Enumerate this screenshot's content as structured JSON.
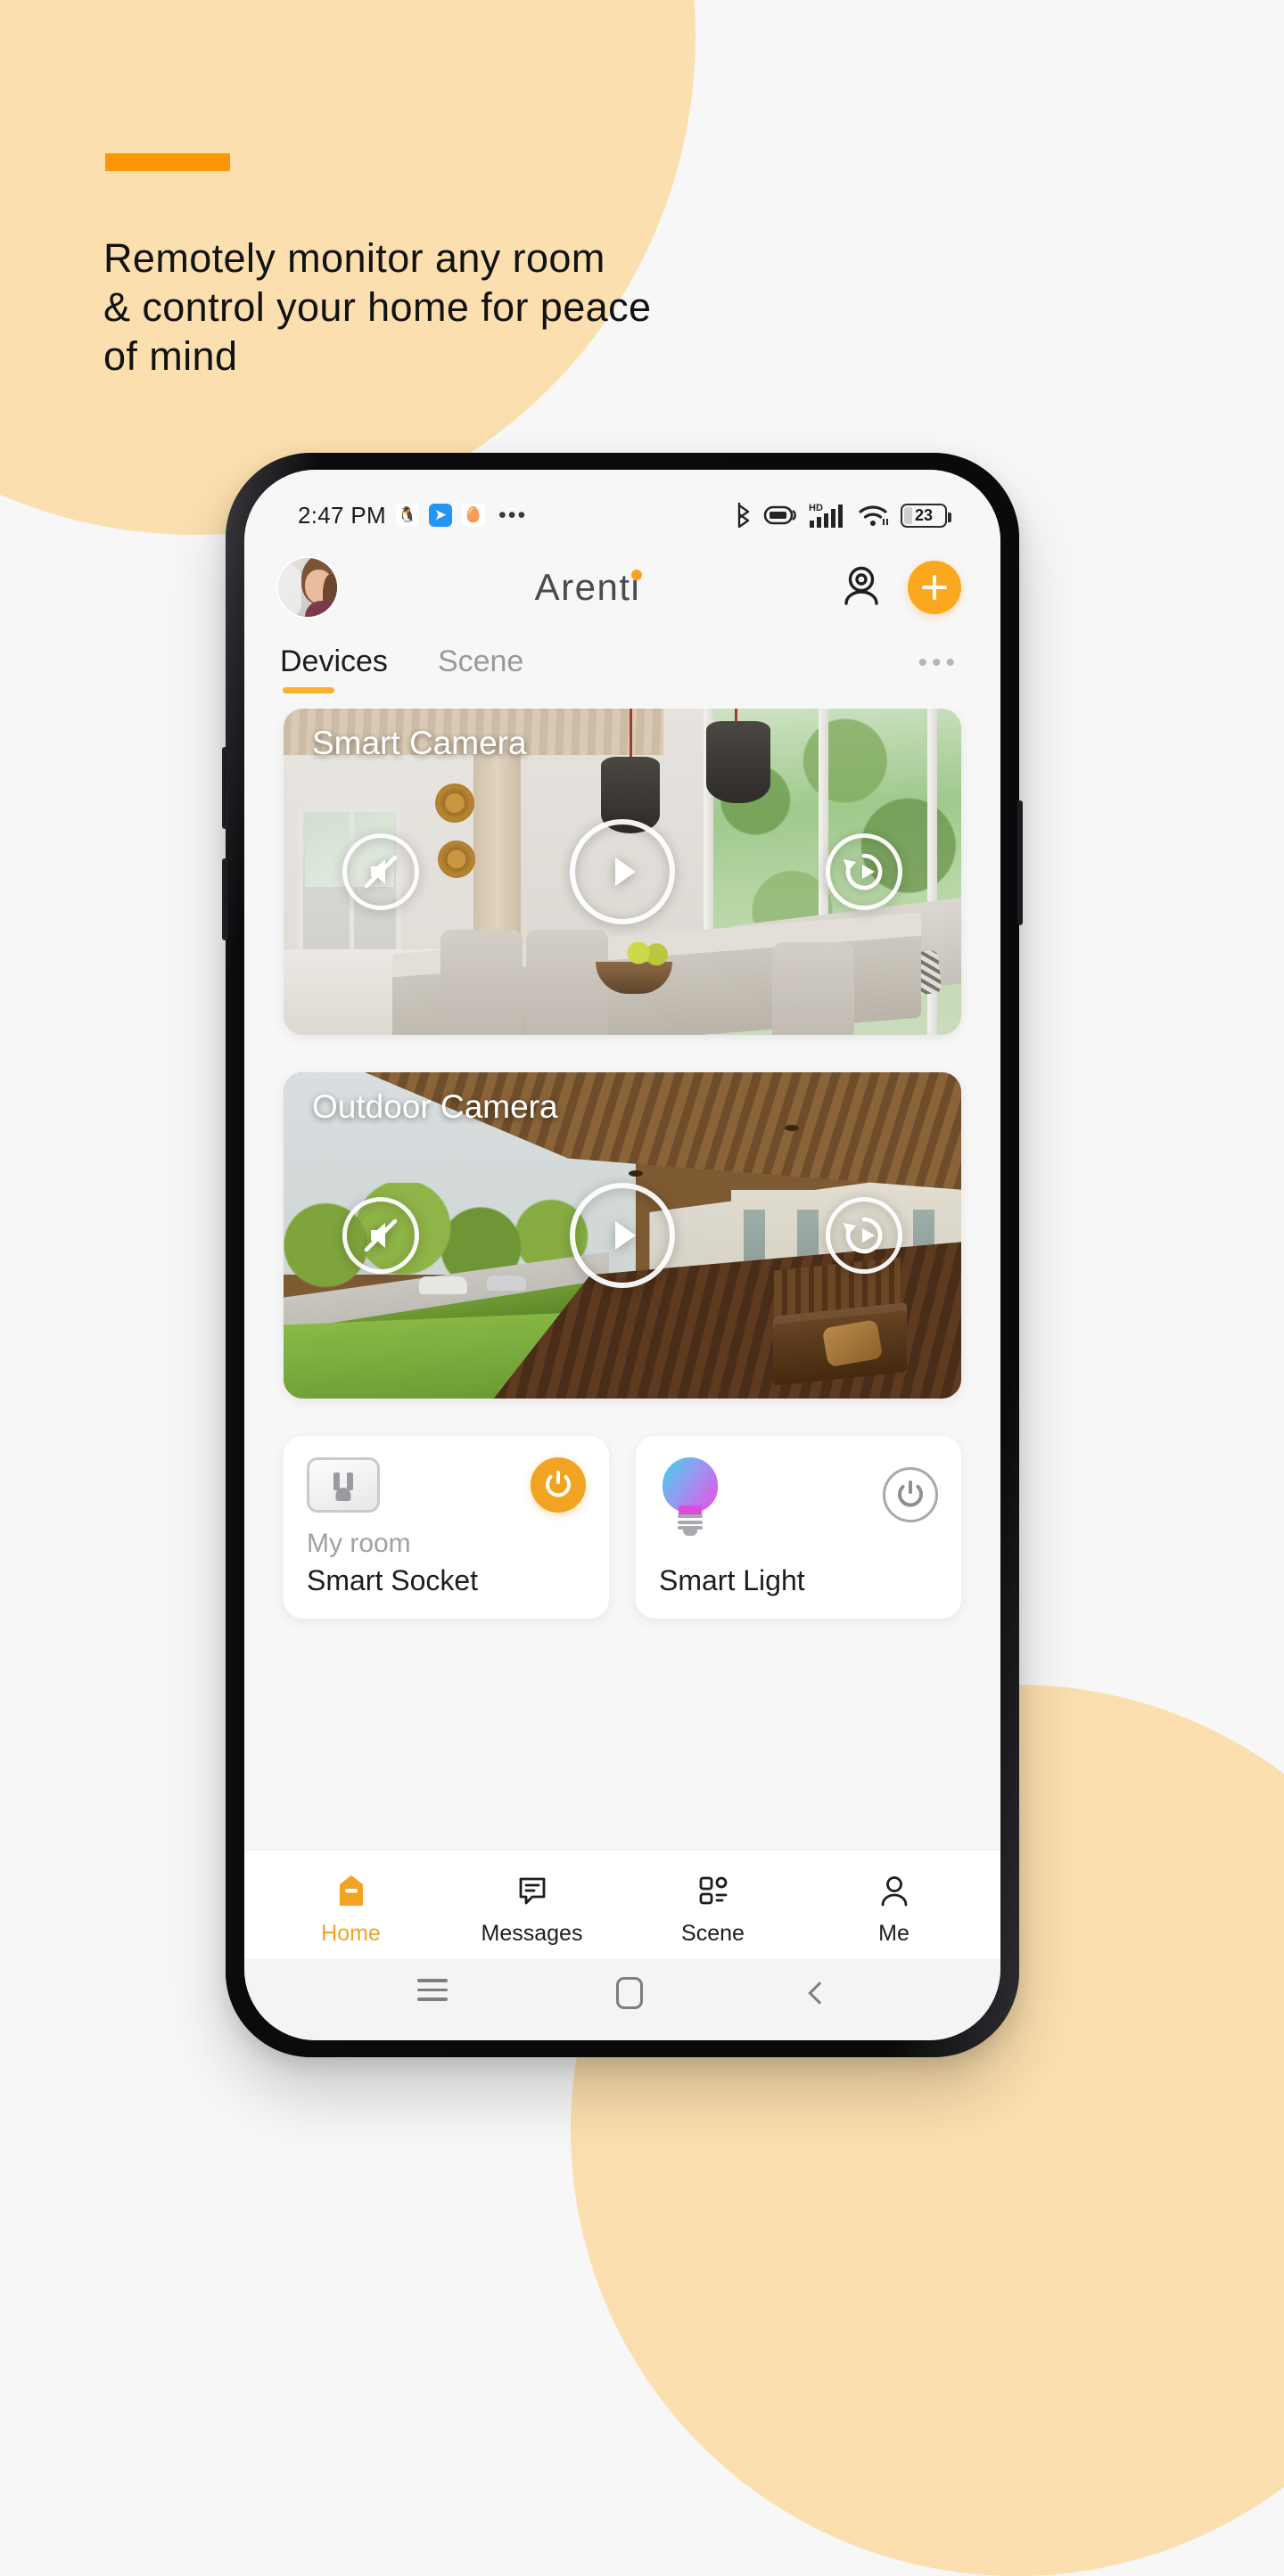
{
  "marketing": {
    "accent_color": "#FB9706",
    "headline": "Remotely monitor any room\n& control your home for peace\nof mind"
  },
  "theme": {
    "background": "#F7F7F7",
    "blob_color": "#FBDFAE",
    "brand_orange": "#F2A322",
    "screen_background": "#F7F7F8"
  },
  "phone": {
    "status_bar": {
      "time": "2:47 PM",
      "left_icons": [
        "qq-penguin-icon",
        "blue-bird-icon",
        "egg-app-icon",
        "more-dots-icon"
      ],
      "left_glyphs": {
        "qq": "🐧",
        "bird": "➤",
        "egg": "🥚",
        "dots": "•••"
      },
      "right_icons": [
        "bluetooth-icon",
        "battery-saver-icon",
        "hd-signal-icon",
        "wifi-icon",
        "battery-icon"
      ],
      "hd_label": "HD",
      "battery_level": "23"
    },
    "app_header": {
      "avatar": "user-avatar",
      "brand": "Arenti",
      "brand_dot_color": "#FBA01B",
      "camera_icon": "webcam-icon",
      "add_label": "+"
    },
    "tabs": {
      "items": [
        {
          "label": "Devices",
          "active": true
        },
        {
          "label": "Scene",
          "active": false
        }
      ],
      "more_label": "•••"
    },
    "camera_cards": [
      {
        "title": "Smart Camera",
        "scene": "indoor-dining-room",
        "controls": [
          "mute-off-icon",
          "play-icon",
          "playback-history-icon"
        ]
      },
      {
        "title": "Outdoor Camera",
        "scene": "outdoor-porch",
        "controls": [
          "mute-off-icon",
          "play-icon",
          "playback-history-icon"
        ]
      }
    ],
    "device_tiles": [
      {
        "icon": "power-outlet-icon",
        "room": "My room",
        "name": "Smart Socket",
        "power_state": "on",
        "power_icon": "power-icon"
      },
      {
        "icon": "light-bulb-icon",
        "room": "",
        "name": "Smart Light",
        "power_state": "off",
        "power_icon": "power-icon"
      }
    ],
    "bottom_nav": [
      {
        "label": "Home",
        "icon": "home-icon",
        "active": true
      },
      {
        "label": "Messages",
        "icon": "message-bubble-icon",
        "active": false
      },
      {
        "label": "Scene",
        "icon": "scene-grid-icon",
        "active": false
      },
      {
        "label": "Me",
        "icon": "person-icon",
        "active": false
      }
    ],
    "system_nav": [
      "recents-icon",
      "home-square-icon",
      "back-chevron-icon"
    ]
  }
}
